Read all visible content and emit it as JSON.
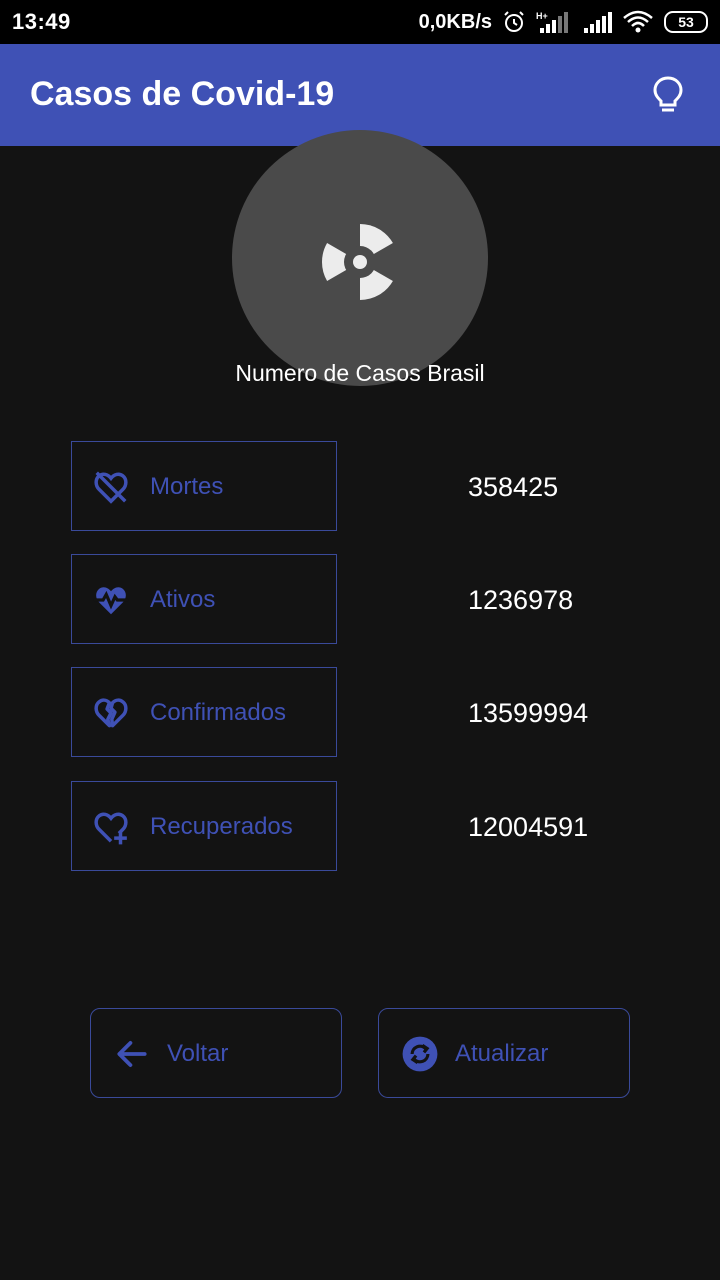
{
  "status_bar": {
    "time": "13:49",
    "net_speed": "0,0KB/s",
    "battery": "53",
    "icons": [
      "alarm-icon",
      "signal-h-plus-icon",
      "signal-icon",
      "wifi-icon",
      "battery-icon"
    ]
  },
  "app_bar": {
    "title": "Casos de Covid-19",
    "action_icon": "lightbulb-icon"
  },
  "hero": {
    "icon": "radiation-icon",
    "caption": "Numero de Casos Brasil"
  },
  "stats": [
    {
      "label": "Mortes",
      "value": "358425",
      "icon": "heart-off-icon"
    },
    {
      "label": "Ativos",
      "value": "1236978",
      "icon": "heart-pulse-icon"
    },
    {
      "label": "Confirmados",
      "value": "13599994",
      "icon": "heart-broken-icon"
    },
    {
      "label": "Recuperados",
      "value": "12004591",
      "icon": "heart-plus-icon"
    }
  ],
  "actions": {
    "back_label": "Voltar",
    "refresh_label": "Atualizar"
  },
  "colors": {
    "accent": "#3f51b5",
    "background": "#131313",
    "circle": "#4a4a4a"
  }
}
